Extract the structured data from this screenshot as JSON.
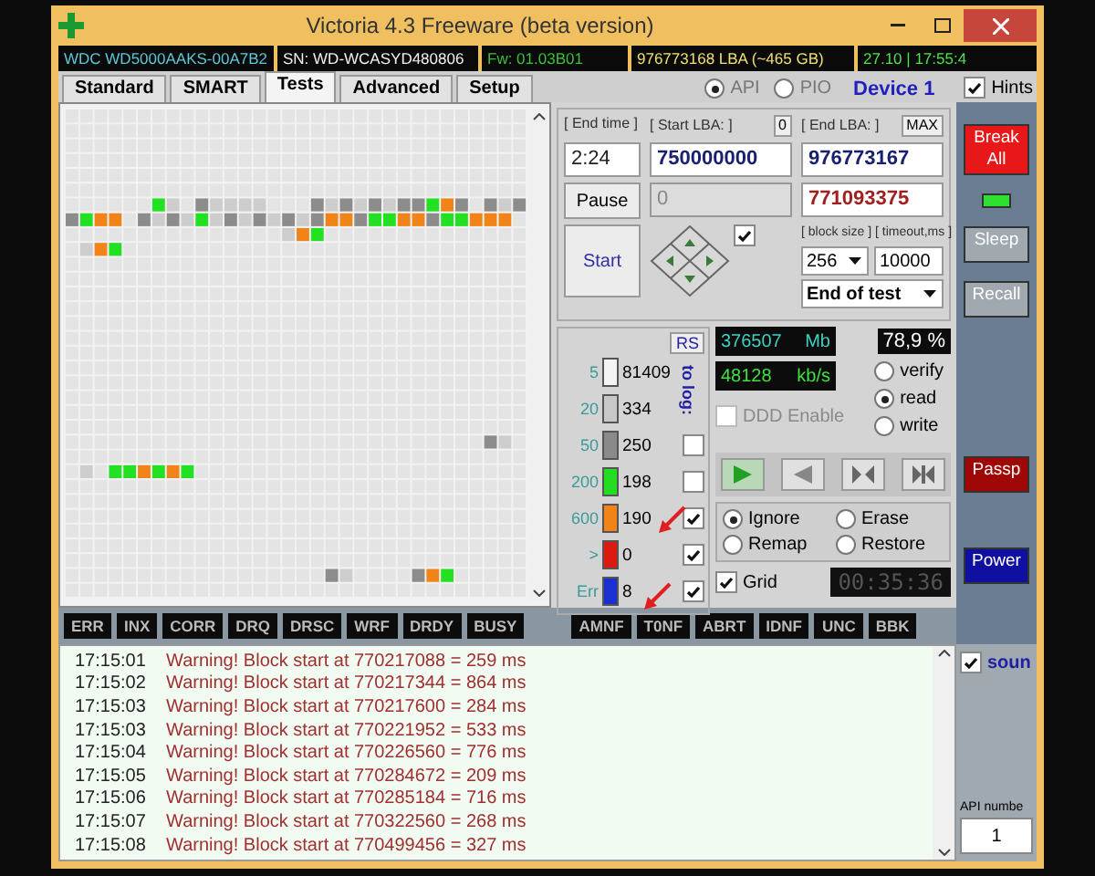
{
  "window": {
    "title": "Victoria 4.3 Freeware (beta version)"
  },
  "info_bar": [
    {
      "text": "WDC WD5000AAKS-00A7B2"
    },
    {
      "text": "SN: WD-WCASYD480806"
    },
    {
      "text": "Fw: 01.03B01"
    },
    {
      "text": "976773168 LBA (~465 GB)"
    },
    {
      "text": "27.10 | 17:55:4"
    }
  ],
  "tabs": [
    {
      "label": "Standard",
      "selected": false
    },
    {
      "label": "SMART",
      "selected": false
    },
    {
      "label": "Tests",
      "selected": true
    },
    {
      "label": "Advanced",
      "selected": false
    },
    {
      "label": "Setup",
      "selected": false
    }
  ],
  "api_radios": [
    {
      "label": "API",
      "selected": true
    },
    {
      "label": "PIO",
      "selected": false
    }
  ],
  "device": "Device 1",
  "hints": {
    "label": "Hints",
    "checked": true
  },
  "end_time": {
    "label": "[ End time ]",
    "value": "2:24"
  },
  "start_lba": {
    "label": "[ Start LBA: ]",
    "button": "0",
    "value": "750000000"
  },
  "end_lba": {
    "label": "[ End LBA: ]",
    "button": "MAX",
    "value": "976773167"
  },
  "disabled_field": "0",
  "current_lba": "771093375",
  "pause_button": "Pause",
  "start_button": "Start",
  "direction_checked": true,
  "block_size": {
    "label": "[ block size ]",
    "value": "256"
  },
  "timeout": {
    "label": "[ timeout,ms ]",
    "value": "10000"
  },
  "end_action": "End of test",
  "rs_button": "RS",
  "to_log_label": "to log:",
  "counters": [
    {
      "threshold": "5",
      "count": "81409",
      "color": "#f4f4f4"
    },
    {
      "threshold": "20",
      "count": "334",
      "color": "#c8c8c8"
    },
    {
      "threshold": "50",
      "count": "250",
      "color": "#8a8a8a",
      "to_log": false
    },
    {
      "threshold": "200",
      "count": "198",
      "color": "#22dd22",
      "to_log": false
    },
    {
      "threshold": "600",
      "count": "190",
      "color": "#f08418",
      "to_log": true
    },
    {
      "threshold": ">",
      "count": "0",
      "color": "#dd1a10",
      "to_log": true
    },
    {
      "threshold": "Err",
      "count": "8",
      "color": "#1a30d0",
      "to_log": true
    }
  ],
  "stats": {
    "mb": "376507",
    "mb_unit": "Mb",
    "percent": "78,9 %",
    "speed": "48128",
    "speed_unit": "kb/s"
  },
  "ddd_enable": {
    "label": "DDD Enable",
    "checked": false
  },
  "mode_radios": [
    {
      "label": "verify",
      "selected": false
    },
    {
      "label": "read",
      "selected": true
    },
    {
      "label": "write",
      "selected": false
    }
  ],
  "transport": [
    {
      "kind": "play",
      "selected": true
    },
    {
      "kind": "back",
      "selected": false
    },
    {
      "kind": "skip-back",
      "selected": false
    },
    {
      "kind": "skip-end",
      "selected": false
    }
  ],
  "repair_radios": [
    {
      "label": "Ignore",
      "selected": true
    },
    {
      "label": "Erase",
      "selected": false
    },
    {
      "label": "Remap",
      "selected": false
    },
    {
      "label": "Restore",
      "selected": false
    }
  ],
  "grid": {
    "label": "Grid",
    "checked": true
  },
  "timer": "00:35:36",
  "side_buttons": [
    {
      "label": "Break All",
      "kind": "alert"
    },
    {
      "kind": "led"
    },
    {
      "label": "Sleep",
      "kind": "plain"
    },
    {
      "label": "Recall",
      "kind": "plain"
    },
    {
      "label": "Passp",
      "kind": "warn"
    },
    {
      "label": "Power",
      "kind": "power"
    }
  ],
  "flags_left": [
    "ERR",
    "INX",
    "CORR",
    "DRQ",
    "DRSC",
    "WRF",
    "DRDY",
    "BUSY"
  ],
  "flags_right": [
    "AMNF",
    "T0NF",
    "ABRT",
    "IDNF",
    "UNC",
    "BBK"
  ],
  "log": [
    {
      "time": "17:15:01",
      "message": "Warning! Block start at 770217088 = 259 ms"
    },
    {
      "time": "17:15:02",
      "message": "Warning! Block start at 770217344 = 864 ms"
    },
    {
      "time": "17:15:03",
      "message": "Warning! Block start at 770217600 = 284 ms"
    },
    {
      "time": "17:15:03",
      "message": "Warning! Block start at 770221952 = 533 ms"
    },
    {
      "time": "17:15:04",
      "message": "Warning! Block start at 770226560 = 776 ms"
    },
    {
      "time": "17:15:05",
      "message": "Warning! Block start at 770284672 = 209 ms"
    },
    {
      "time": "17:15:06",
      "message": "Warning! Block start at 770285184 = 716 ms"
    },
    {
      "time": "17:15:07",
      "message": "Warning! Block start at 770322560 = 268 ms"
    },
    {
      "time": "17:15:08",
      "message": "Warning! Block start at 770499456 = 327 ms"
    }
  ],
  "sound": {
    "label": "soun",
    "checked": true
  },
  "api_number": {
    "label": "API numbe",
    "value": "1"
  }
}
